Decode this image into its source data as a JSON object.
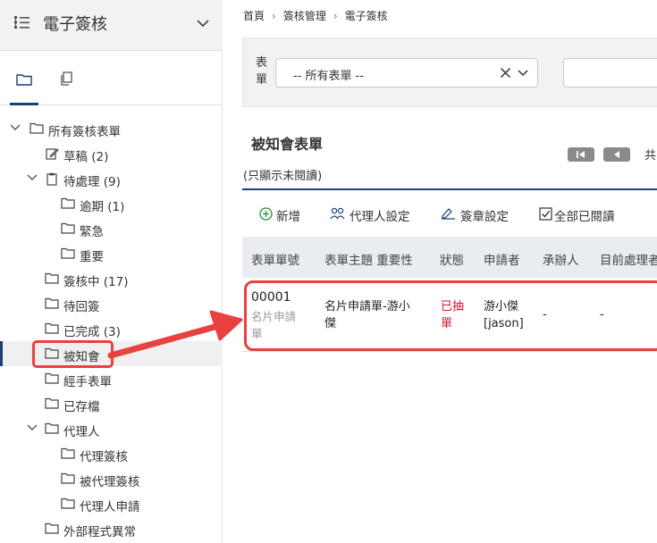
{
  "sidebar": {
    "title": "電子簽核",
    "tree": {
      "root": "所有簽核表單",
      "draft": "草稿 (2)",
      "pending": "待處理 (9)",
      "overdue": "逾期 (1)",
      "urgent": "緊急",
      "important": "重要",
      "in_review": "簽核中 (17)",
      "await_reply": "待回簽",
      "completed": "已完成 (3)",
      "notify": "被知會",
      "handled": "經手表單",
      "archived": "已存檔",
      "agent": "代理人",
      "agent_sign": "代理簽核",
      "being_agent": "被代理簽核",
      "agent_apply": "代理人申請",
      "external_error": "外部程式異常"
    }
  },
  "breadcrumb": [
    "首頁",
    "簽核管理",
    "電子簽核"
  ],
  "filter": {
    "label": "表單",
    "select_value": "-- 所有表單 --"
  },
  "list": {
    "title": "被知會表單",
    "note": "(只顯示未閱讀)",
    "page_total_prefix": "共"
  },
  "toolbar": {
    "add": "新增",
    "agent_settings": "代理人設定",
    "signature_settings": "簽章設定",
    "mark_all_read": "全部已閱讀"
  },
  "table": {
    "columns": [
      "表單單號",
      "表單主題 重要性",
      "狀態",
      "申請者",
      "承辦人",
      "目前處理者"
    ],
    "rows": [
      {
        "id": "00001",
        "form_name": "名片申請單",
        "subject": "名片申請單-游小傑",
        "status": "已抽單",
        "applicant": "游小傑 [jason]",
        "handler": "-",
        "current": "-"
      }
    ]
  },
  "colors": {
    "accent": "#1c3f78",
    "highlight": "#e8413f",
    "status_withdrawn": "#d0132f"
  }
}
